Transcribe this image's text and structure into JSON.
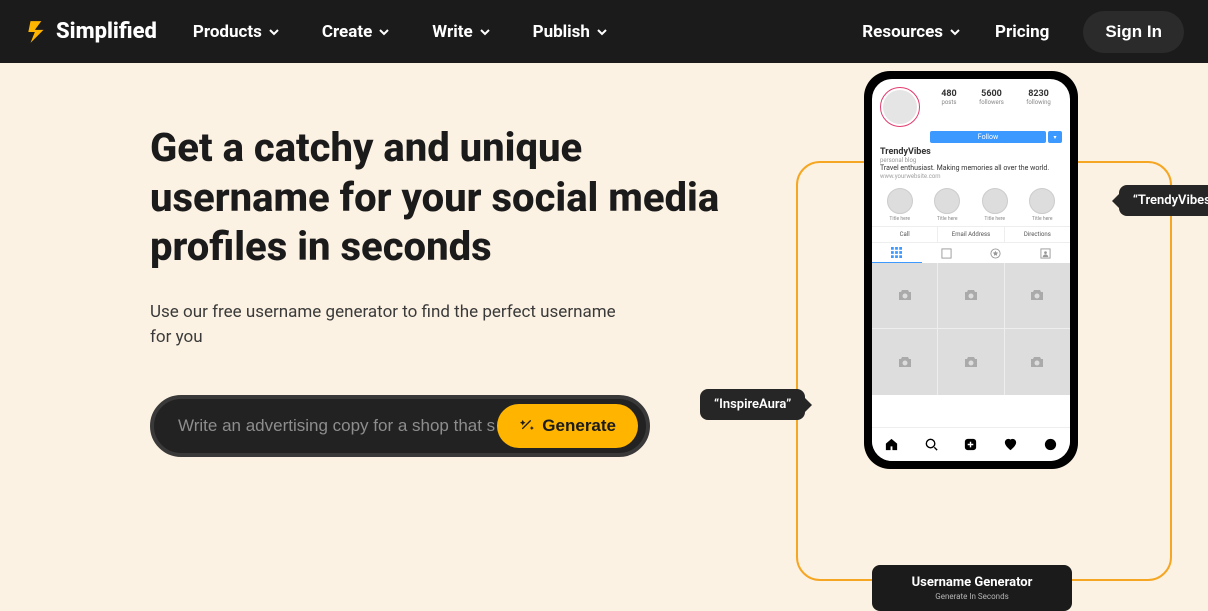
{
  "nav": {
    "brand": "Simplified",
    "items": [
      "Products",
      "Create",
      "Write",
      "Publish"
    ],
    "resources": "Resources",
    "pricing": "Pricing",
    "signin": "Sign In"
  },
  "hero": {
    "title": "Get a catchy and unique username for your social media profiles in seconds",
    "subtitle": "Use our free username generator to find the perfect username for you",
    "placeholder": "Write an advertising copy for a shop that s",
    "button": "Generate"
  },
  "phone": {
    "stats": [
      {
        "num": "480",
        "label": "posts"
      },
      {
        "num": "5600",
        "label": "followers"
      },
      {
        "num": "8230",
        "label": "following"
      }
    ],
    "follow": "Follow",
    "name": "TrendyVibes",
    "category": "personal blog",
    "bio": "Travel enthusiast. Making memories all over the world.",
    "link": "www.yourwebsite.com",
    "highlight_label": "Title here",
    "contacts": [
      "Call",
      "Email Address",
      "Directions"
    ]
  },
  "tooltips": {
    "t1": "“TrendyVibes”",
    "t2": "“InspireAura”"
  },
  "card": {
    "title": "Username Generator",
    "sub": "Generate In Seconds"
  }
}
